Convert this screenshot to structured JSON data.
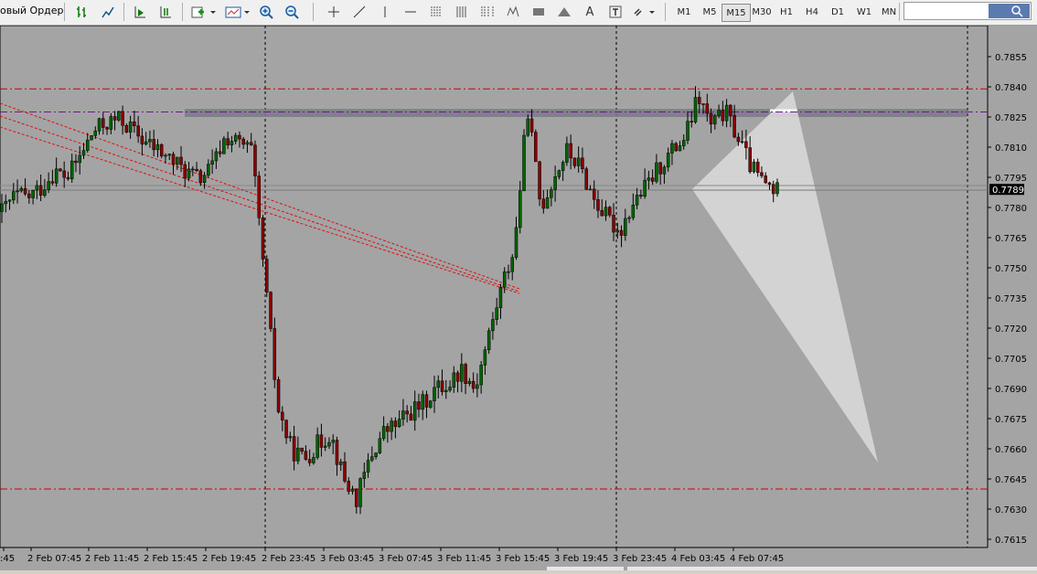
{
  "toolbar": {
    "new_order_label": "овый Ордер",
    "timeframes": [
      "M1",
      "M5",
      "M15",
      "M30",
      "H1",
      "H4",
      "D1",
      "W1",
      "MN"
    ],
    "active_timeframe": "M15",
    "text_tool_label": "A"
  },
  "colors": {
    "chart_bg": "#a4a4a4",
    "bull_candle": "#006400",
    "bear_candle": "#8b0000",
    "hline": "#cc0000",
    "resistance_band": "#7a7a88",
    "fan": "#dcdcdc",
    "price_tag_bg": "#000000"
  },
  "chart": {
    "current_price_label": "0.7789",
    "price_ticks": [
      "0.7855",
      "0.7840",
      "0.7825",
      "0.7810",
      "0.7795",
      "0.7780",
      "0.7765",
      "0.7750",
      "0.7735",
      "0.7720",
      "0.7705",
      "0.7690",
      "0.7675",
      "0.7660",
      "0.7645",
      "0.7630",
      "0.7615"
    ],
    "time_labels": [
      ":45",
      "2 Feb 07:45",
      "2 Feb 11:45",
      "2 Feb 15:45",
      "2 Feb 19:45",
      "2 Feb 23:45",
      "3 Feb 03:45",
      "3 Feb 07:45",
      "3 Feb 11:45",
      "3 Feb 15:45",
      "3 Feb 19:45",
      "3 Feb 23:45",
      "4 Feb 03:45",
      "4 Feb 07:45"
    ]
  },
  "chart_data": {
    "type": "candlestick",
    "symbol_timeframe": "M15",
    "ylim": [
      0.7615,
      0.7865
    ],
    "current_price": 0.7789,
    "horizontal_levels": [
      0.7839,
      0.764
    ],
    "resistance_band": [
      0.7825,
      0.7829
    ],
    "x": [
      ":45",
      "2 Feb 07:45",
      "2 Feb 11:45",
      "2 Feb 15:45",
      "2 Feb 19:45",
      "2 Feb 23:45",
      "3 Feb 03:45",
      "3 Feb 07:45",
      "3 Feb 11:45",
      "3 Feb 15:45",
      "3 Feb 19:45",
      "3 Feb 23:45",
      "4 Feb 03:45",
      "4 Feb 07:45"
    ],
    "close_path": [
      0.7778,
      0.7786,
      0.7785,
      0.779,
      0.7798,
      0.7795,
      0.7806,
      0.7818,
      0.7822,
      0.7824,
      0.7818,
      0.7812,
      0.7808,
      0.7803,
      0.7798,
      0.7794,
      0.78,
      0.7815,
      0.7812,
      0.7808,
      0.7745,
      0.768,
      0.766,
      0.7655,
      0.7662,
      0.7668,
      0.7645,
      0.7635,
      0.7655,
      0.7668,
      0.7672,
      0.7678,
      0.7682,
      0.769,
      0.7692,
      0.77,
      0.769,
      0.7715,
      0.774,
      0.776,
      0.783,
      0.778,
      0.7795,
      0.7808,
      0.78,
      0.7785,
      0.7775,
      0.7768,
      0.7782,
      0.779,
      0.78,
      0.7808,
      0.7815,
      0.7835,
      0.782,
      0.7828,
      0.7815,
      0.78,
      0.7792,
      0.7788
    ]
  }
}
